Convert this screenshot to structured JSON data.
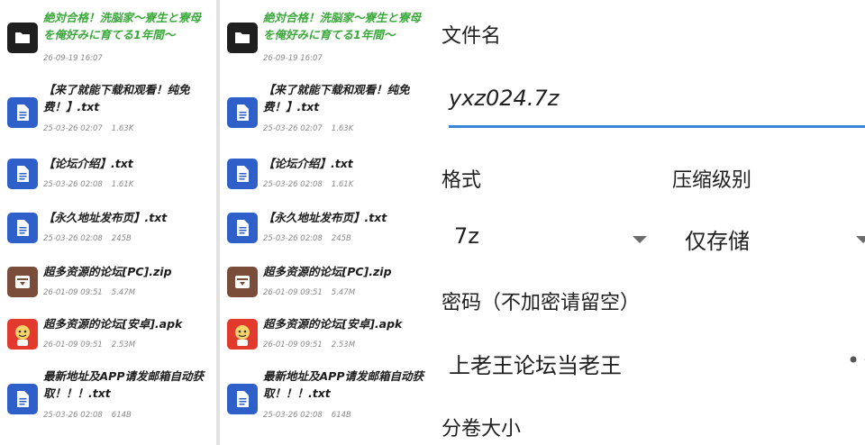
{
  "files": [
    {
      "name": "絶対合格！洗脳家～寮生と寮母を俺好みに育てる1年間～",
      "date": "26-09-19 16:07",
      "size": "",
      "type": "folder",
      "highlight": true
    },
    {
      "name": "【来了就能下载和观看！纯免费！】.txt",
      "date": "25-03-26 02:07",
      "size": "1.63K",
      "type": "doc",
      "highlight": false
    },
    {
      "name": "【论坛介绍】.txt",
      "date": "25-03-26 02:08",
      "size": "1.61K",
      "type": "doc",
      "highlight": false
    },
    {
      "name": "【永久地址发布页】.txt",
      "date": "25-03-26 02:08",
      "size": "245B",
      "type": "doc",
      "highlight": false
    },
    {
      "name": "超多资源的论坛[PC].zip",
      "date": "26-01-09 09:51",
      "size": "5.47M",
      "type": "zip",
      "highlight": false
    },
    {
      "name": "超多资源的论坛[安卓].apk",
      "date": "26-01-09 09:51",
      "size": "2.53M",
      "type": "apk",
      "highlight": false
    },
    {
      "name": "最新地址及APP请发邮箱自动获取！！！.txt",
      "date": "25-03-26 02:08",
      "size": "614B",
      "type": "doc",
      "highlight": false
    }
  ],
  "form": {
    "filename_label": "文件名",
    "filename_value": "yxz024.7z",
    "format_label": "格式",
    "format_value": "7z",
    "level_label": "压缩级别",
    "level_value": "仅存储",
    "password_label": "密码（不加密请留空）",
    "password_value": "上老王论坛当老王",
    "password_toggle": "••",
    "split_label": "分卷大小"
  },
  "colors": {
    "accent": "#3a86d6",
    "doc_icon": "#2f5fc9",
    "folder_icon": "#1f1f1f",
    "zip_icon": "#7a4d3a",
    "apk_icon": "#e23a2d",
    "highlight_text": "#3aa83a"
  }
}
